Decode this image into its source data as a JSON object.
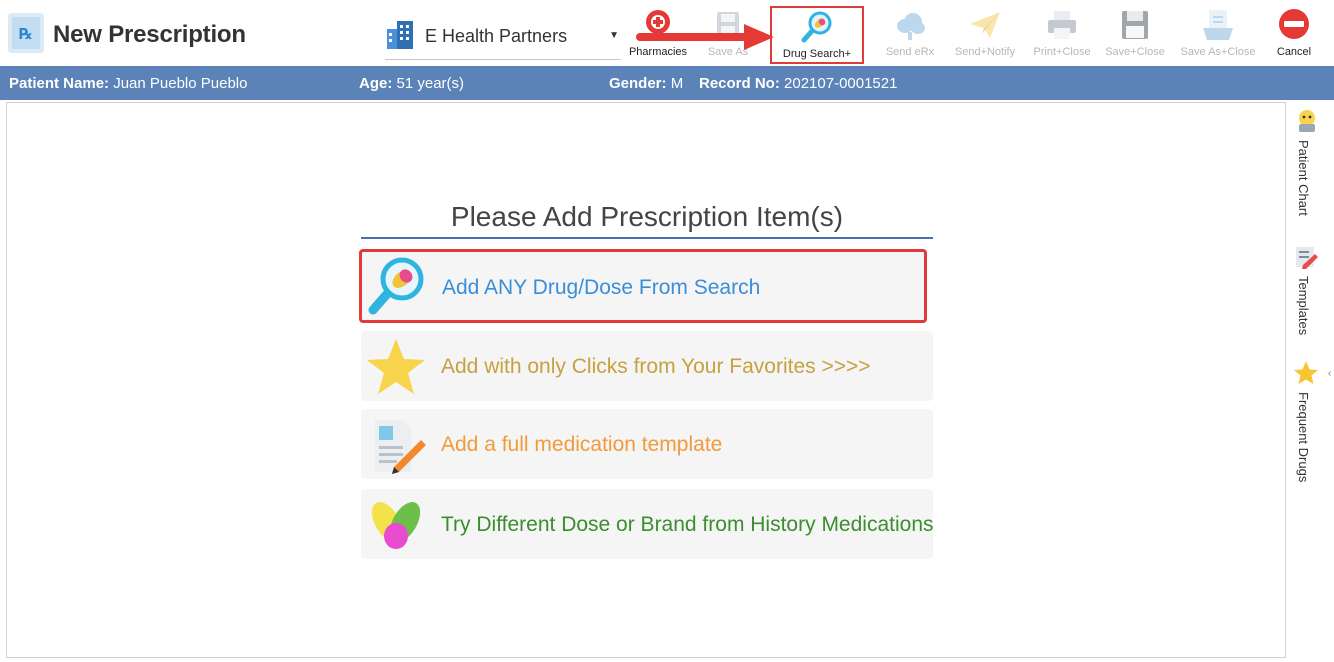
{
  "header": {
    "title": "New Prescription",
    "practice": "E Health Partners"
  },
  "toolbar": {
    "pharmacies": "Pharmacies",
    "save_as": "Save As",
    "drug_search": "Drug Search+",
    "send_erx": "Send eRx",
    "send_notify": "Send+Notify",
    "print_close": "Print+Close",
    "save_close": "Save+Close",
    "save_as_close": "Save As+Close",
    "cancel": "Cancel"
  },
  "patient": {
    "name_label": "Patient Name:",
    "name": "Juan Pueblo Pueblo",
    "age_label": "Age:",
    "age": "51 year(s)",
    "gender_label": "Gender:",
    "gender": "M",
    "record_label": "Record No:",
    "record": "202107-0001521"
  },
  "main": {
    "heading": "Please Add Prescription Item(s)",
    "options": [
      {
        "label": "Add ANY Drug/Dose From Search",
        "icon": "drug-search-icon"
      },
      {
        "label": "Add with only Clicks from Your Favorites >>>>",
        "icon": "star-icon"
      },
      {
        "label": "Add a full medication template",
        "icon": "template-pencil-icon"
      },
      {
        "label": "Try Different Dose or Brand from History Medications",
        "icon": "pills-icon"
      }
    ]
  },
  "side_tabs": {
    "chart": "Patient Chart",
    "templates": "Templates",
    "frequent": "Frequent Drugs"
  },
  "colors": {
    "patient_bar": "#5b83b8",
    "highlight": "#e03a3a",
    "search_text": "#3a8ed8",
    "favorites_text": "#c7a140",
    "template_text": "#f29a3b",
    "history_text": "#3c8d2f"
  }
}
